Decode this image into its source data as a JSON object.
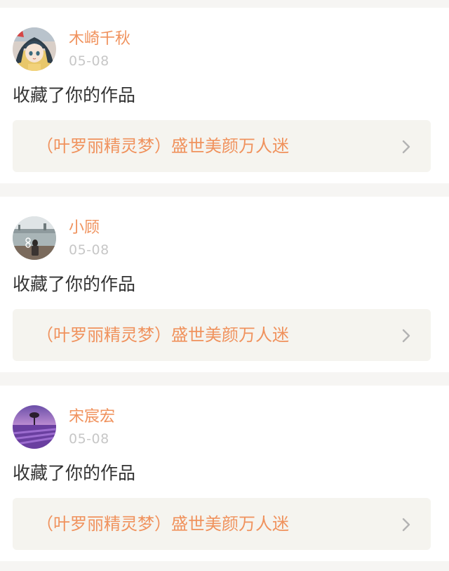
{
  "notifications": [
    {
      "username": "木崎千秋",
      "date": "05-08",
      "action": "收藏了你的作品",
      "work_title": "（叶罗丽精灵梦）盛世美颜万人迷",
      "avatar_icon": "anime-girl-avatar"
    },
    {
      "username": "小顾",
      "date": "05-08",
      "action": "收藏了你的作品",
      "work_title": "（叶罗丽精灵梦）盛世美颜万人迷",
      "avatar_icon": "lakeside-photo-avatar"
    },
    {
      "username": "宋宸宏",
      "date": "05-08",
      "action": "收藏了你的作品",
      "work_title": "（叶罗丽精灵梦）盛世美颜万人迷",
      "avatar_icon": "lavender-field-avatar"
    }
  ],
  "colors": {
    "accent": "#f0925d",
    "date_gray": "#c7c7c7",
    "text_dark": "#333333",
    "link_background": "#f5f4ef",
    "page_background": "#f6f5f3"
  }
}
